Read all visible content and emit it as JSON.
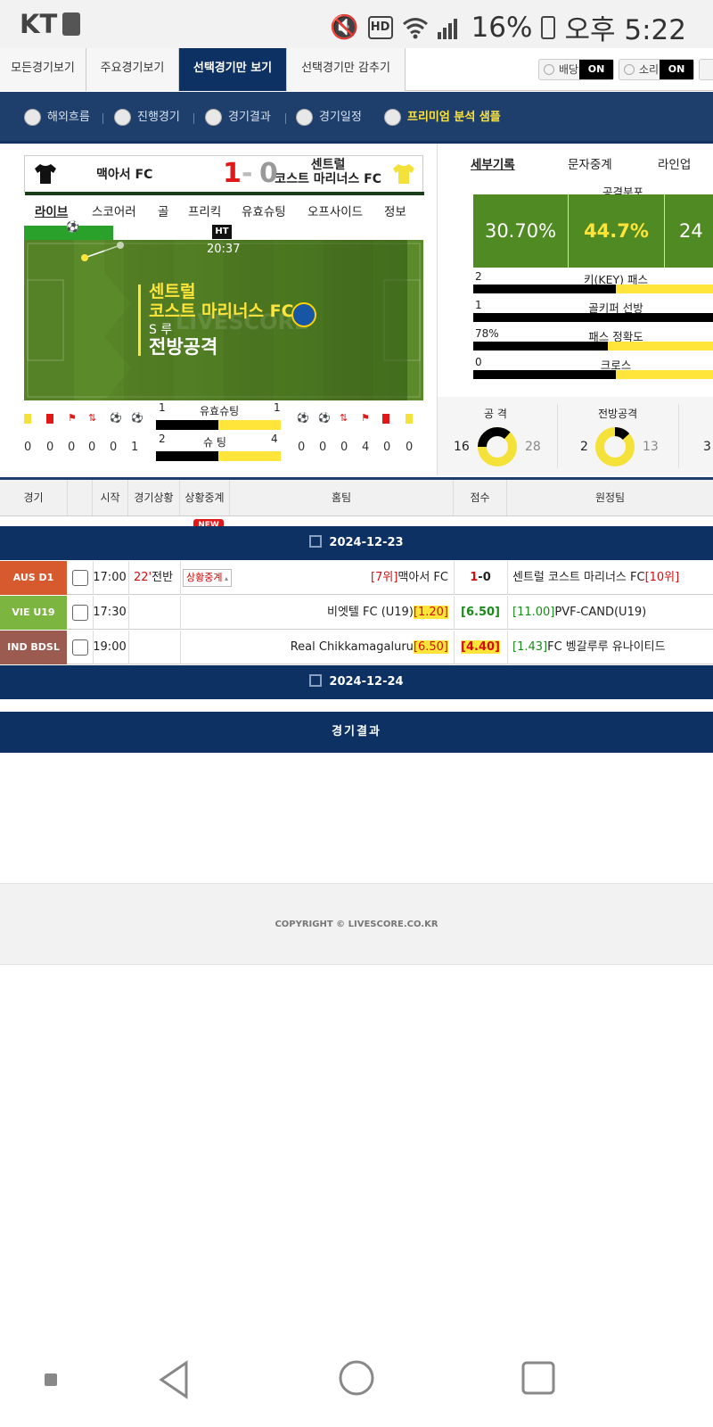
{
  "status_bar": {
    "carrier": "KT",
    "battery": "16%",
    "time": "오후 5:22",
    "hd_label": "HD"
  },
  "top_tabs": {
    "items": [
      "모든경기보기",
      "주요경기보기",
      "선택경기만 보기",
      "선택경기만 감추기"
    ],
    "active": "선택경기만 보기",
    "odds_label": "배당",
    "odds_state": "ON",
    "sound_label": "소리",
    "sound_state": "ON"
  },
  "filters": {
    "items": [
      "해외흐름",
      "진행경기",
      "경기결과",
      "경기일정"
    ],
    "premium": "프리미엄 분석 샘플"
  },
  "live": {
    "home": "맥아서 FC",
    "away_line1": "센트럴",
    "away_line2": "코스트 마리너스 FC",
    "score_home": "1",
    "score_sep": "-",
    "score_away": "0",
    "tabs": [
      "라이브",
      "스코어러",
      "골",
      "프리킥",
      "유효슈팅",
      "오프사이드",
      "정보"
    ],
    "ht": "HT",
    "clock": "20:37",
    "event_team_1": "센트럴",
    "event_team_2": "코스트 마리너스 FC",
    "event_sub": "S 루",
    "event_action": "전방공격",
    "watermark": "LIVESCORE",
    "home_stats": [
      "0",
      "0",
      "0",
      "0",
      "0",
      "1"
    ],
    "away_stats": [
      "0",
      "0",
      "0",
      "4",
      "0",
      "0"
    ],
    "shots_on": {
      "label": "유효슈팅",
      "home": "1",
      "away": "1",
      "home_ratio": 0.5
    },
    "shots": {
      "label": "슈 팅",
      "home": "2",
      "away": "4",
      "home_ratio": 0.5
    }
  },
  "right_panel": {
    "tabs": [
      "세부기록",
      "문자중계",
      "라인업"
    ],
    "distribution_title": "공격분포",
    "distribution": [
      "30.70%",
      "44.7%",
      "24"
    ],
    "rows": [
      {
        "label": "키(KEY) 패스",
        "home": "2",
        "home_ratio": 0.57
      },
      {
        "label": "골키퍼 선방",
        "home": "1",
        "home_ratio": 1.0
      },
      {
        "label": "패스 정확도",
        "home": "78%",
        "home_ratio": 0.54
      },
      {
        "label": "크로스",
        "home": "0",
        "home_ratio": 0.57
      }
    ],
    "attack": {
      "label": "공 격",
      "home": "16",
      "away": "28"
    },
    "forward_attack": {
      "label": "전방공격",
      "home": "2",
      "away": "13"
    },
    "third_home": "3"
  },
  "table": {
    "headers": [
      "경기",
      "",
      "시작",
      "경기상황",
      "상황중계",
      "홈팀",
      "점수",
      "원정팀"
    ],
    "new_badge": "NEW",
    "date1": "2024-12-23",
    "date2": "2024-12-24",
    "rows": [
      {
        "league": "AUS D1",
        "league_color": "#d65a2e",
        "time": "17:00",
        "minute": "22'",
        "period": "전반",
        "live_label": "상황중계",
        "home_rank": "[7위]",
        "home": "맥아서 FC",
        "score_home": "1",
        "score_sep": "-",
        "score_away": "0",
        "away": "센트럴 코스트 마리너스 FC",
        "away_rank": "[10위]"
      },
      {
        "league": "VIE U19",
        "league_color": "#7db541",
        "time": "17:30",
        "home": "비엣텔 FC (U19)",
        "home_odds": "[1.20]",
        "mid_odds": "[6.50]",
        "away_odds": "[11.00]",
        "away": "PVF-CAND(U19)"
      },
      {
        "league": "IND BDSL",
        "league_color": "#9b5b50",
        "time": "19:00",
        "home": "Real Chikkamagaluru",
        "home_odds": "[6.50]",
        "mid_odds": "[4.40]",
        "away_odds": "[1.43]",
        "away": "FC 벵갈루루 유나이티드"
      }
    ]
  },
  "result_bar": "경기결과",
  "footer": "COPYRIGHT © LIVESCORE.CO.KR"
}
